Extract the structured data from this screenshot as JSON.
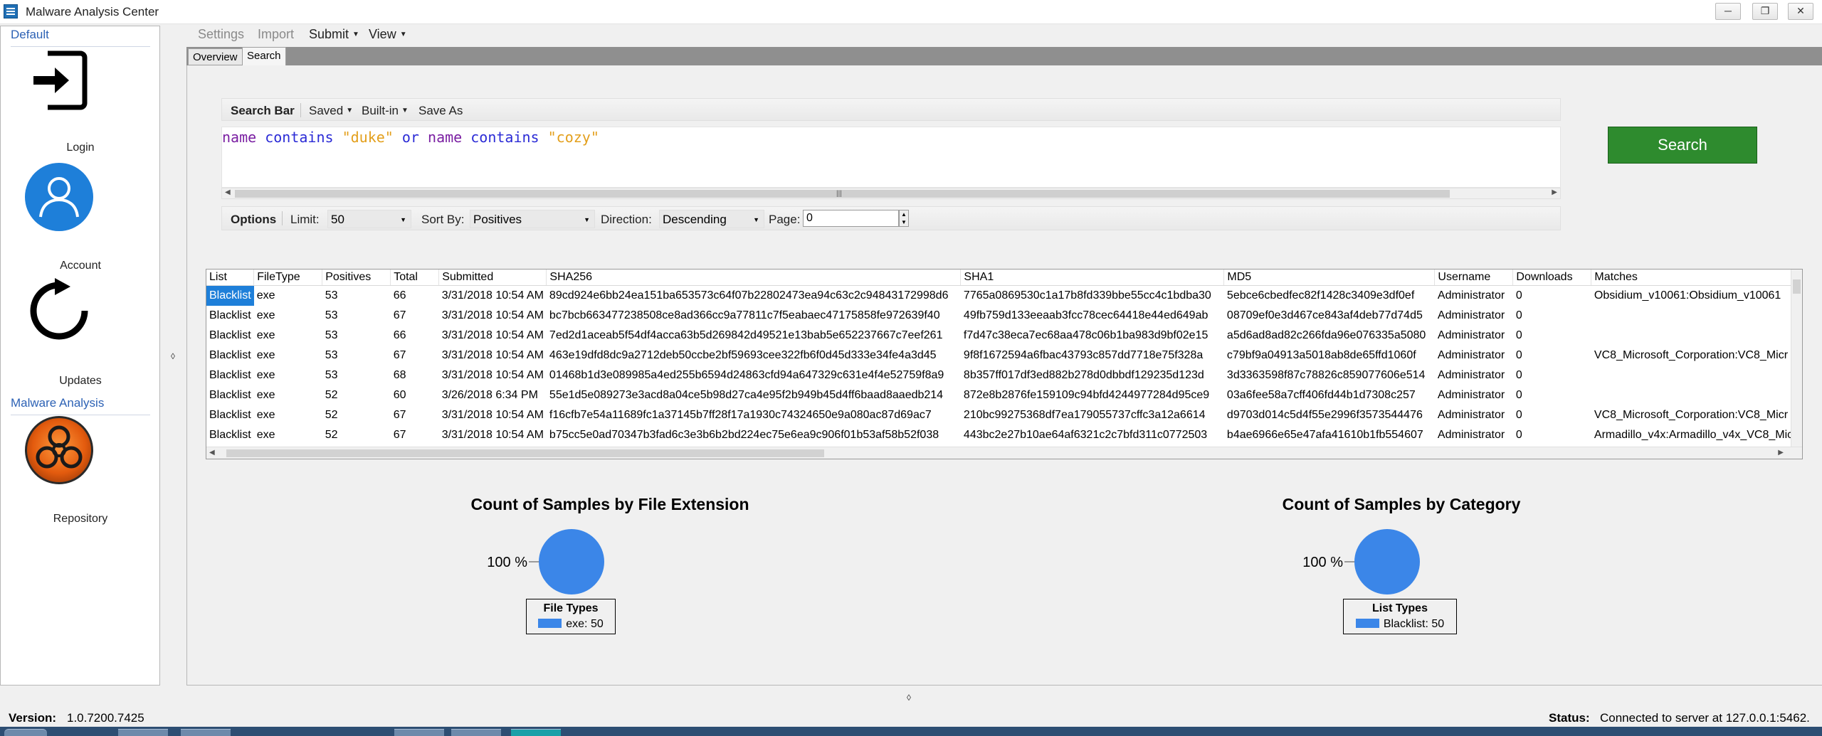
{
  "window": {
    "title": "Malware Analysis Center",
    "minimize": "─",
    "maximize": "❐",
    "close": "✕"
  },
  "sidebar": {
    "section_default": "Default",
    "section_malware": "Malware Analysis",
    "items": [
      {
        "label": "Login",
        "icon": "login-icon"
      },
      {
        "label": "Account",
        "icon": "account-icon"
      },
      {
        "label": "Updates",
        "icon": "updates-icon"
      },
      {
        "label": "Repository",
        "icon": "biohazard-icon"
      }
    ]
  },
  "menubar": {
    "settings": "Settings",
    "import": "Import",
    "submit": "Submit",
    "view": "View"
  },
  "tabs": {
    "overview": "Overview",
    "search": "Search",
    "active": "Search"
  },
  "search_bar": {
    "title": "Search Bar",
    "saved": "Saved",
    "builtin": "Built-in",
    "save_as": "Save As",
    "query": {
      "t1": "name",
      "t2": "contains",
      "t3": "\"duke\"",
      "t4": "or",
      "t5": "name",
      "t6": "contains",
      "t7": "\"cozy\""
    },
    "button": "Search"
  },
  "options": {
    "title": "Options",
    "limit_label": "Limit:",
    "limit_value": "50",
    "sort_label": "Sort By:",
    "sort_value": "Positives",
    "direction_label": "Direction:",
    "direction_value": "Descending",
    "page_label": "Page:",
    "page_value": "0"
  },
  "results": {
    "columns": [
      "List",
      "FileType",
      "Positives",
      "Total",
      "Submitted",
      "SHA256",
      "SHA1",
      "MD5",
      "Username",
      "Downloads",
      "Matches"
    ],
    "rows": [
      [
        "Blacklist",
        "exe",
        "53",
        "66",
        "3/31/2018 10:54 AM",
        "89cd924e6bb24ea151ba653573c64f07b22802473ea94c63c2c94843172998d6",
        "7765a0869530c1a17b8fd339bbe55cc4c1bdba30",
        "5ebce6cbedfec82f1428c3409e3df0ef",
        "Administrator",
        "0",
        "Obsidium_v10061:Obsidium_v10061"
      ],
      [
        "Blacklist",
        "exe",
        "53",
        "67",
        "3/31/2018 10:54 AM",
        "bc7bcb663477238508ce8ad366cc9a77811c7f5eabaec47175858fe972639f40",
        "49fb759d133eeaab3fcc78cec64418e44ed649ab",
        "08709ef0e3d467ce843af4deb77d74d5",
        "Administrator",
        "0",
        ""
      ],
      [
        "Blacklist",
        "exe",
        "53",
        "66",
        "3/31/2018 10:54 AM",
        "7ed2d1aceab5f54df4acca63b5d269842d49521e13bab5e652237667c7eef261",
        "f7d47c38eca7ec68aa478c06b1ba983d9bf02e15",
        "a5d6ad8ad82c266fda96e076335a5080",
        "Administrator",
        "0",
        ""
      ],
      [
        "Blacklist",
        "exe",
        "53",
        "67",
        "3/31/2018 10:54 AM",
        "463e19dfd8dc9a2712deb50ccbe2bf59693cee322fb6f0d45d333e34fe4a3d45",
        "9f8f1672594a6fbac43793c857dd7718e75f328a",
        "c79bf9a04913a5018ab8de65ffd1060f",
        "Administrator",
        "0",
        "VC8_Microsoft_Corporation:VC8_Micr"
      ],
      [
        "Blacklist",
        "exe",
        "53",
        "68",
        "3/31/2018 10:54 AM",
        "01468b1d3e089985a4ed255b6594d24863cfd94a647329c631e4f4e52759f8a9",
        "8b357ff017df3ed882b278d0dbbdf129235d123d",
        "3d3363598f87c78826c859077606e514",
        "Administrator",
        "0",
        ""
      ],
      [
        "Blacklist",
        "exe",
        "52",
        "60",
        "3/26/2018 6:34 PM",
        "55e1d5e089273e3acd8a04ce5b98d27ca4e95f2b949b45d4ff6baad8aaedb214",
        "872e8b2876fe159109c94bfd4244977284d95ce9",
        "03a6fee58a7cff406fd44b1d7308c257",
        "Administrator",
        "0",
        ""
      ],
      [
        "Blacklist",
        "exe",
        "52",
        "67",
        "3/31/2018 10:54 AM",
        "f16cfb7e54a11689fc1a37145b7ff28f17a1930c74324650e9a080ac87d69ac7",
        "210bc99275368df7ea179055737cffc3a12a6614",
        "d9703d014c5d4f55e2996f3573544476",
        "Administrator",
        "0",
        "VC8_Microsoft_Corporation:VC8_Micr"
      ],
      [
        "Blacklist",
        "exe",
        "52",
        "67",
        "3/31/2018 10:54 AM",
        "b75cc5e0ad70347b3fad6c3e3b6b2bd224ec75e6ea9c906f01b53af58b52f038",
        "443bc2e27b10ae64af6321c2c7bfd311c0772503",
        "b4ae6966e65e47afa41610b1fb554607",
        "Administrator",
        "0",
        "Armadillo_v4x:Armadillo_v4x_VC8_Mic"
      ]
    ]
  },
  "chart_data": [
    {
      "type": "pie",
      "title": "Count of Samples by File Extension",
      "legend_title": "File Types",
      "labels": [
        "exe"
      ],
      "values": [
        50
      ],
      "percent_label": "100 %",
      "legend_entry": "exe: 50",
      "colors": [
        "#3b86e8"
      ],
      "legend_position": "bottom"
    },
    {
      "type": "pie",
      "title": "Count of Samples by Category",
      "legend_title": "List Types",
      "labels": [
        "Blacklist"
      ],
      "values": [
        50
      ],
      "percent_label": "100 %",
      "legend_entry": "Blacklist: 50",
      "colors": [
        "#3b86e8"
      ],
      "legend_position": "bottom"
    }
  ],
  "statusbar": {
    "version_label": "Version:",
    "version_value": "1.0.7200.7425",
    "status_label": "Status:",
    "status_value": "Connected to server at 127.0.0.1:5462."
  },
  "colors": {
    "accent": "#1e7fd9",
    "search_button": "#2e8b2e",
    "pie": "#3b86e8"
  }
}
